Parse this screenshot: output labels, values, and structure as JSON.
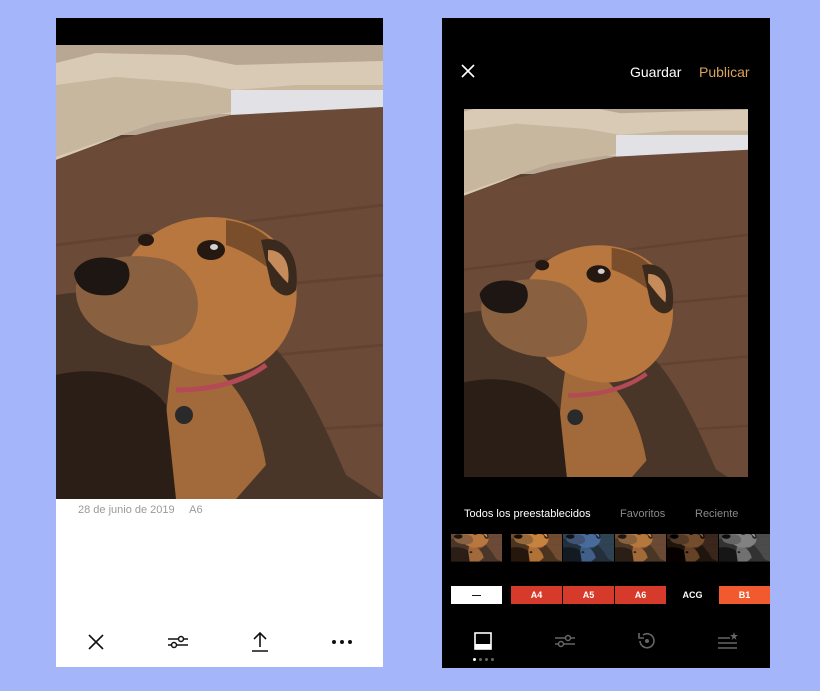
{
  "left_screen": {
    "date": "28 de junio de 2019",
    "preset": "A6",
    "toolbar": [
      "close-icon",
      "adjust-sliders-icon",
      "share-upload-icon",
      "more-dots-icon"
    ]
  },
  "right_screen": {
    "header": {
      "save_label": "Guardar",
      "publish_label": "Publicar"
    },
    "tabs": [
      {
        "label": "Todos los preestablecidos",
        "active": true
      },
      {
        "label": "Favoritos",
        "active": false
      },
      {
        "label": "Reciente",
        "active": false
      }
    ],
    "presets": [
      {
        "label": "—",
        "label_bg": "#ffffff",
        "label_color": "#000000",
        "tint": "none"
      },
      {
        "label": "A4",
        "label_bg": "#d63a2b",
        "label_color": "#ffffff",
        "tint": "warm"
      },
      {
        "label": "A5",
        "label_bg": "#d63a2b",
        "label_color": "#ffffff",
        "tint": "cool"
      },
      {
        "label": "A6",
        "label_bg": "#d63a2b",
        "label_color": "#ffffff",
        "tint": "warm2"
      },
      {
        "label": "ACG",
        "label_bg": "#000000",
        "label_color": "#ffffff",
        "tint": "dark"
      },
      {
        "label": "B1",
        "label_bg": "#f05a2e",
        "label_color": "#ffffff",
        "tint": "bw"
      }
    ],
    "toolbar": [
      "presets-icon",
      "adjust-sliders-icon",
      "history-icon",
      "recipes-icon"
    ]
  },
  "colors": {
    "background": "#a4b5fa",
    "publish_accent": "#d9a25f",
    "preset_red": "#d63a2b"
  }
}
